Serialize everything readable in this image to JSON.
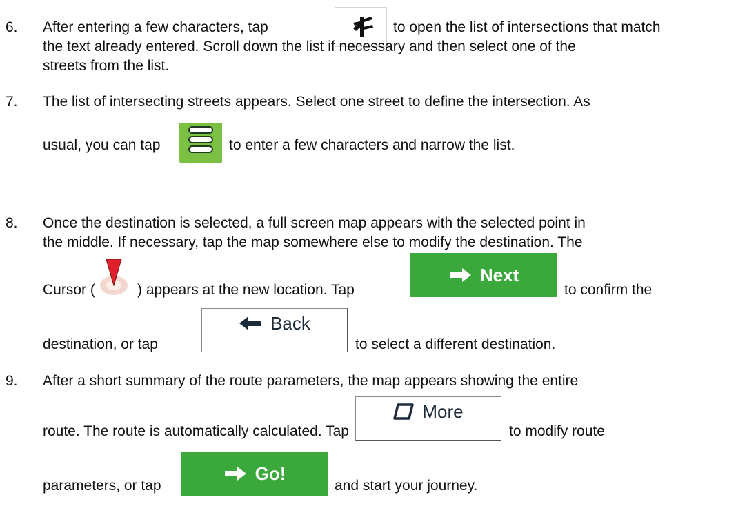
{
  "steps": [
    {
      "num": "6.",
      "lines": [
        "After entering a few characters, tap",
        "to open the list of intersections that match",
        "the text already entered. Scroll down the list if necessary and then select one of the",
        "streets from the list."
      ],
      "icon": "intersection-icon"
    },
    {
      "num": "7.",
      "lines": [
        "The list of intersecting streets appears. Select one street to define the intersection. As",
        "usual, you can tap",
        "to enter a few characters and narrow the list."
      ],
      "icon": "list-menu-icon"
    },
    {
      "num": "8.",
      "lines": [
        "Once the destination is selected, a full screen map appears with the selected point in",
        "the middle. If necessary, tap the map somewhere else to modify the destination. The",
        "Cursor (",
        ") appears at the new location. Tap",
        "to confirm the",
        "destination, or tap",
        "to select a different destination."
      ],
      "icon": "cursor-pin-icon",
      "next_button": "Next",
      "back_button": "Back"
    },
    {
      "num": "9.",
      "lines": [
        "After a short summary of the route parameters, the map appears showing the entire",
        "route. The route is automatically calculated. Tap",
        "to modify route",
        "parameters, or tap",
        "and start your journey."
      ],
      "more_button": "More",
      "go_button": "Go!"
    }
  ],
  "colors": {
    "green_button": "#3aa83a",
    "menu_button": "#7cc043",
    "cursor_red": "#e0202a"
  }
}
